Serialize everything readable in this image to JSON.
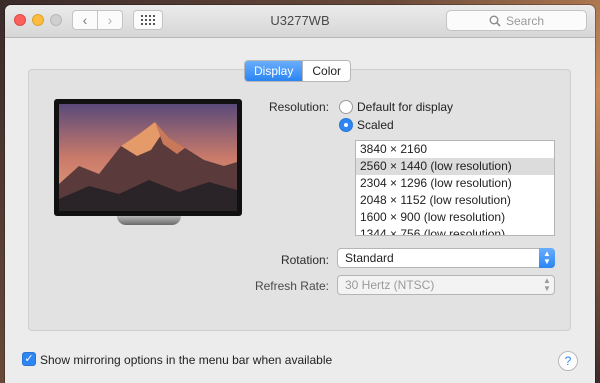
{
  "window": {
    "title": "U3277WB"
  },
  "toolbar": {
    "back_glyph": "‹",
    "forward_glyph": "›",
    "search_placeholder": "Search"
  },
  "tabs": [
    {
      "label": "Display",
      "selected": true
    },
    {
      "label": "Color",
      "selected": false
    }
  ],
  "resolution": {
    "label": "Resolution:",
    "options": [
      {
        "label": "Default for display",
        "selected": false
      },
      {
        "label": "Scaled",
        "selected": true
      }
    ],
    "list": [
      "3840 × 2160",
      "2560 × 1440 (low resolution)",
      "2304 × 1296 (low resolution)",
      "2048 × 1152 (low resolution)",
      "1600 × 900 (low resolution)",
      "1344 × 756 (low resolution)"
    ],
    "selected_index": 1
  },
  "rotation": {
    "label": "Rotation:",
    "value": "Standard"
  },
  "refresh_rate": {
    "label": "Refresh Rate:",
    "value": "30 Hertz (NTSC)",
    "enabled": false
  },
  "mirroring": {
    "label": "Show mirroring options in the menu bar when available",
    "checked": true
  },
  "help": {
    "glyph": "?"
  },
  "icons": {
    "search": "search-icon",
    "grid": "grid-icon",
    "help": "help-icon",
    "monitor": "monitor-preview-image"
  },
  "colors": {
    "accent": "#2a84f3",
    "window_bg": "#ececec",
    "panel_bg": "#e2e2e2"
  }
}
